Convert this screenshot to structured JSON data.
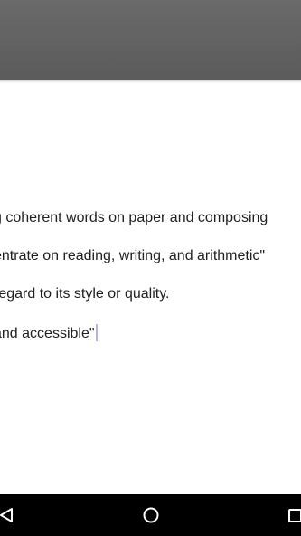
{
  "document": {
    "lines": [
      "g coherent words on paper and composing",
      "entrate on reading, writing, and arithmetic\"",
      " regard to its style or quality.",
      "and accessible\""
    ]
  },
  "colors": {
    "app_bar": "#5f5f5f",
    "text": "#212121",
    "cursor": "#b7b4d6",
    "nav_bar": "#000000"
  },
  "nav": {
    "back_icon": "back-triangle-icon",
    "home_icon": "home-circle-icon",
    "recents_icon": "recents-square-icon"
  }
}
